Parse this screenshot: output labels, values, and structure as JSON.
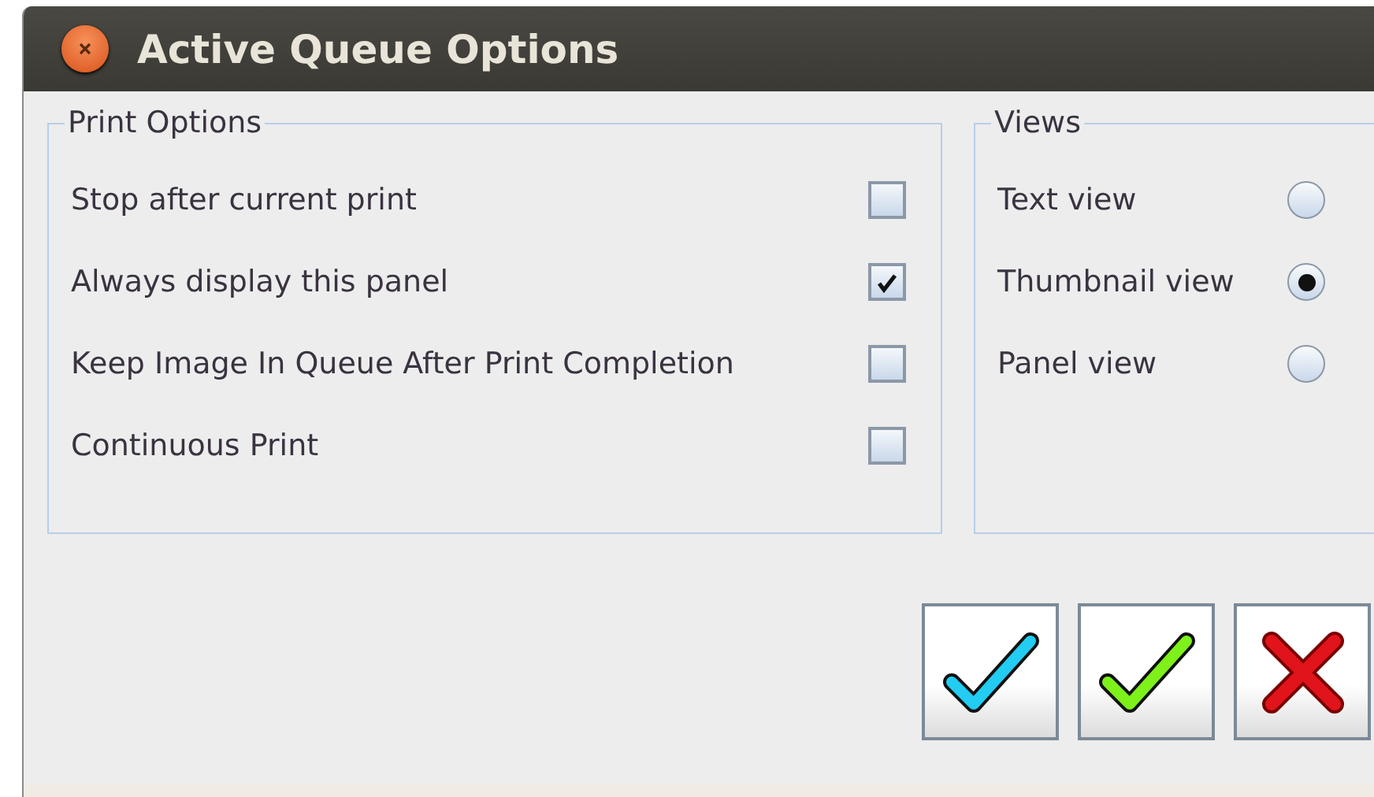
{
  "window": {
    "title": "Active Queue Options"
  },
  "print_options": {
    "title": "Print Options",
    "items": [
      {
        "label": "Stop after current print",
        "checked": false
      },
      {
        "label": "Always display this panel",
        "checked": true
      },
      {
        "label": "Keep Image In Queue After Print Completion",
        "checked": false
      },
      {
        "label": "Continuous Print",
        "checked": false
      }
    ]
  },
  "views": {
    "title": "Views",
    "items": [
      {
        "label": "Text view",
        "selected": false
      },
      {
        "label": "Thumbnail view",
        "selected": true
      },
      {
        "label": "Panel view",
        "selected": false
      }
    ]
  },
  "buttons": [
    {
      "kind": "apply"
    },
    {
      "kind": "ok"
    },
    {
      "kind": "cancel"
    }
  ]
}
